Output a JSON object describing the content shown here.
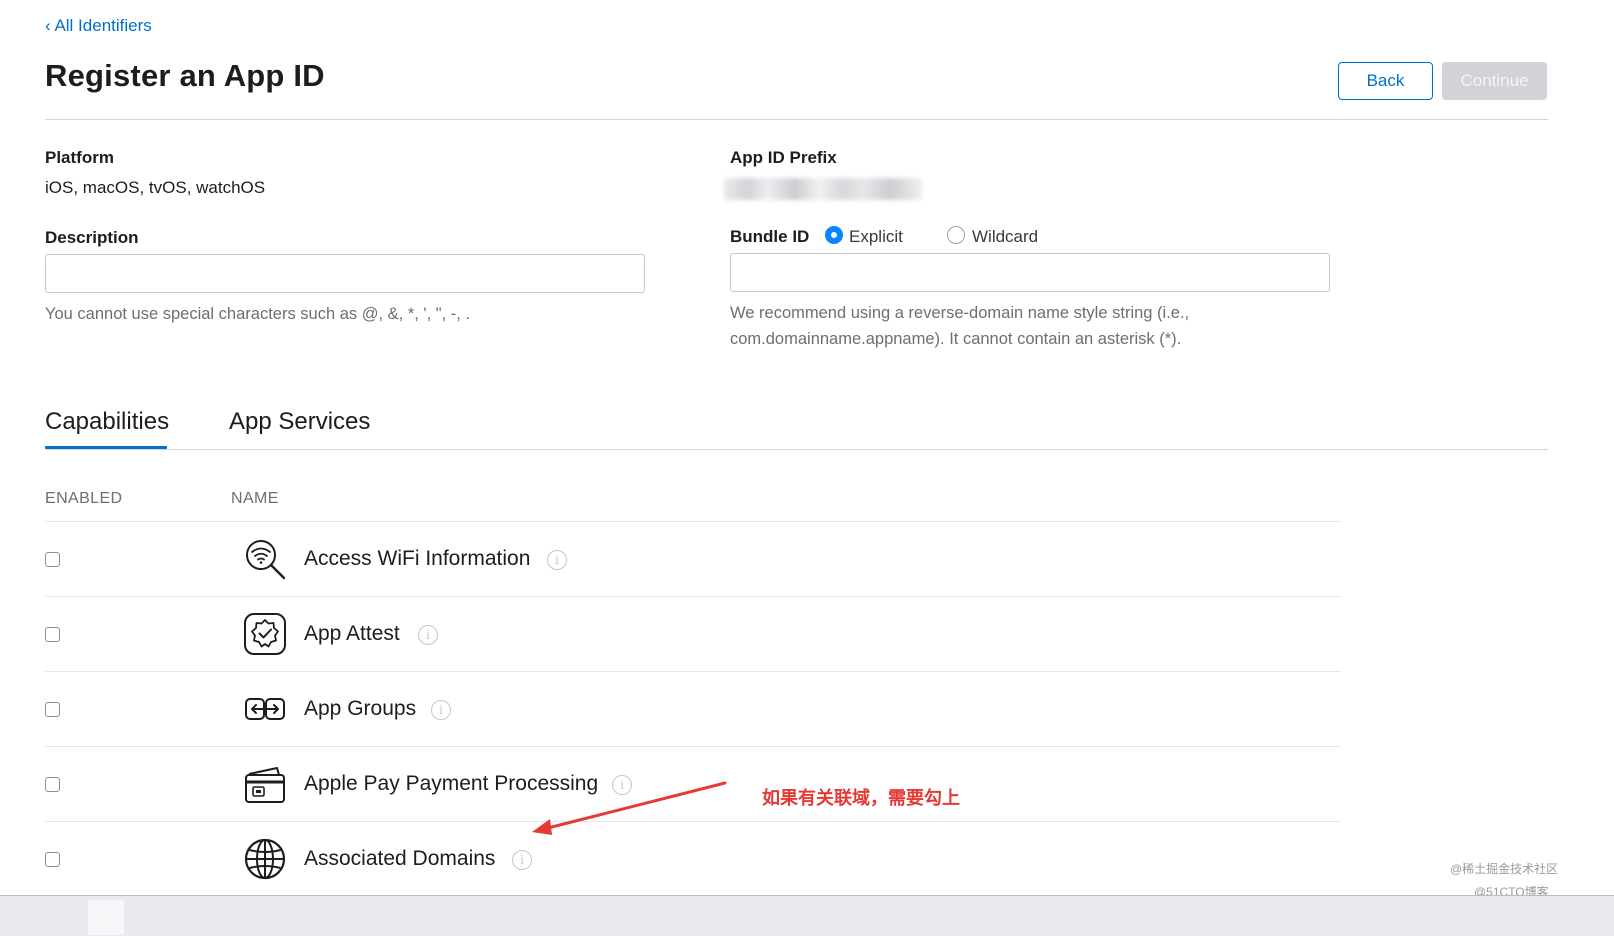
{
  "header": {
    "back_link": "‹ All Identifiers",
    "title": "Register an App ID",
    "back_button": "Back",
    "continue_button": "Continue"
  },
  "platform": {
    "label": "Platform",
    "value": "iOS, macOS, tvOS, watchOS"
  },
  "app_id_prefix": {
    "label": "App ID Prefix"
  },
  "description": {
    "label": "Description",
    "value": "",
    "hint": "You cannot use special characters such as @, &, *, ', \", -, ."
  },
  "bundle_id": {
    "label": "Bundle ID",
    "options": [
      {
        "label": "Explicit",
        "selected": true
      },
      {
        "label": "Wildcard",
        "selected": false
      }
    ],
    "value": "",
    "hint_line1": "We recommend using a reverse-domain name style string (i.e.,",
    "hint_line2": "com.domainname.appname). It cannot contain an asterisk (*)."
  },
  "tabs": [
    {
      "label": "Capabilities",
      "active": true
    },
    {
      "label": "App Services",
      "active": false
    }
  ],
  "table": {
    "columns": [
      "ENABLED",
      "NAME"
    ],
    "rows": [
      {
        "name": "Access WiFi Information",
        "enabled": false,
        "icon": "wifi-search-icon"
      },
      {
        "name": "App Attest",
        "enabled": false,
        "icon": "badge-check-icon"
      },
      {
        "name": "App Groups",
        "enabled": false,
        "icon": "app-groups-icon"
      },
      {
        "name": "Apple Pay Payment Processing",
        "enabled": false,
        "icon": "credit-card-icon"
      },
      {
        "name": "Associated Domains",
        "enabled": false,
        "icon": "globe-icon"
      }
    ]
  },
  "annotation": {
    "text": "如果有关联域，需要勾上",
    "color": "#e53935"
  },
  "watermarks": [
    "@稀土掘金技术社区",
    "@51CTO博客"
  ],
  "colors": {
    "accent": "#0070c9",
    "radio_on": "#0a84ff",
    "disabled_button": "#d2d2d7"
  }
}
